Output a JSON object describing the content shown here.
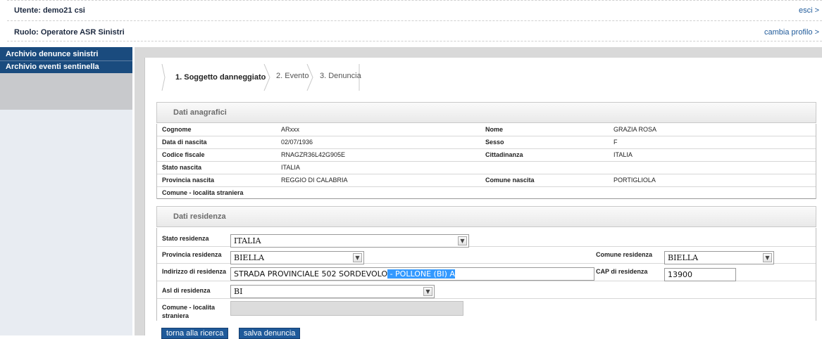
{
  "header": {
    "user_label": "Utente: demo21 csi",
    "role_label": "Ruolo: Operatore ASR Sinistri",
    "logout_link": "esci >",
    "change_profile_link": "cambia profilo >"
  },
  "sidebar": {
    "items": [
      {
        "label": "Archivio denunce sinistri"
      },
      {
        "label": "Archivio eventi sentinella"
      }
    ]
  },
  "tabs": [
    {
      "label": "1. Soggetto danneggiato",
      "active": true
    },
    {
      "label": "2. Evento",
      "active": false
    },
    {
      "label": "3. Denuncia",
      "active": false
    }
  ],
  "anagrafici": {
    "title": "Dati anagrafici",
    "rows": [
      {
        "l1": "Cognome",
        "v1": "ARxxx",
        "l2": "Nome",
        "v2": "GRAZIA ROSA"
      },
      {
        "l1": "Data di nascita",
        "v1": "02/07/1936",
        "l2": "Sesso",
        "v2": "F"
      },
      {
        "l1": "Codice fiscale",
        "v1": "RNAGZR36L42G905E",
        "l2": "Cittadinanza",
        "v2": "ITALIA"
      },
      {
        "l1": "Stato nascita",
        "v1": "ITALIA",
        "l2": "",
        "v2": ""
      },
      {
        "l1": "Provincia nascita",
        "v1": "REGGIO DI CALABRIA",
        "l2": "Comune nascita",
        "v2": "PORTIGLIOLA"
      },
      {
        "l1": "Comune - localita straniera",
        "v1": "",
        "l2": "",
        "v2": ""
      }
    ]
  },
  "residenza": {
    "title": "Dati residenza",
    "stato_label": "Stato residenza",
    "stato_value": "ITALIA",
    "provincia_label": "Provincia residenza",
    "provincia_value": "BIELLA",
    "comune_label": "Comune residenza",
    "comune_value": "BIELLA",
    "indirizzo_label": "Indirizzo di residenza",
    "indirizzo_value": "STRADA PROVINCIALE 502 SORDEVOLO",
    "indirizzo_selected": " - POLLONE (BI) A",
    "cap_label": "CAP di residenza",
    "cap_value": "13900",
    "asl_label": "Asl di residenza",
    "asl_value": "BI",
    "comune_straniera_label_1": "Comune - localita",
    "comune_straniera_label_2": "straniera",
    "comune_straniera_value": ""
  },
  "buttons": {
    "back": "torna alla ricerca",
    "save": "salva denuncia"
  },
  "colors": {
    "nav_blue": "#1a4b7e",
    "link_blue": "#1f5a9a",
    "selection_blue": "#3399ff"
  }
}
